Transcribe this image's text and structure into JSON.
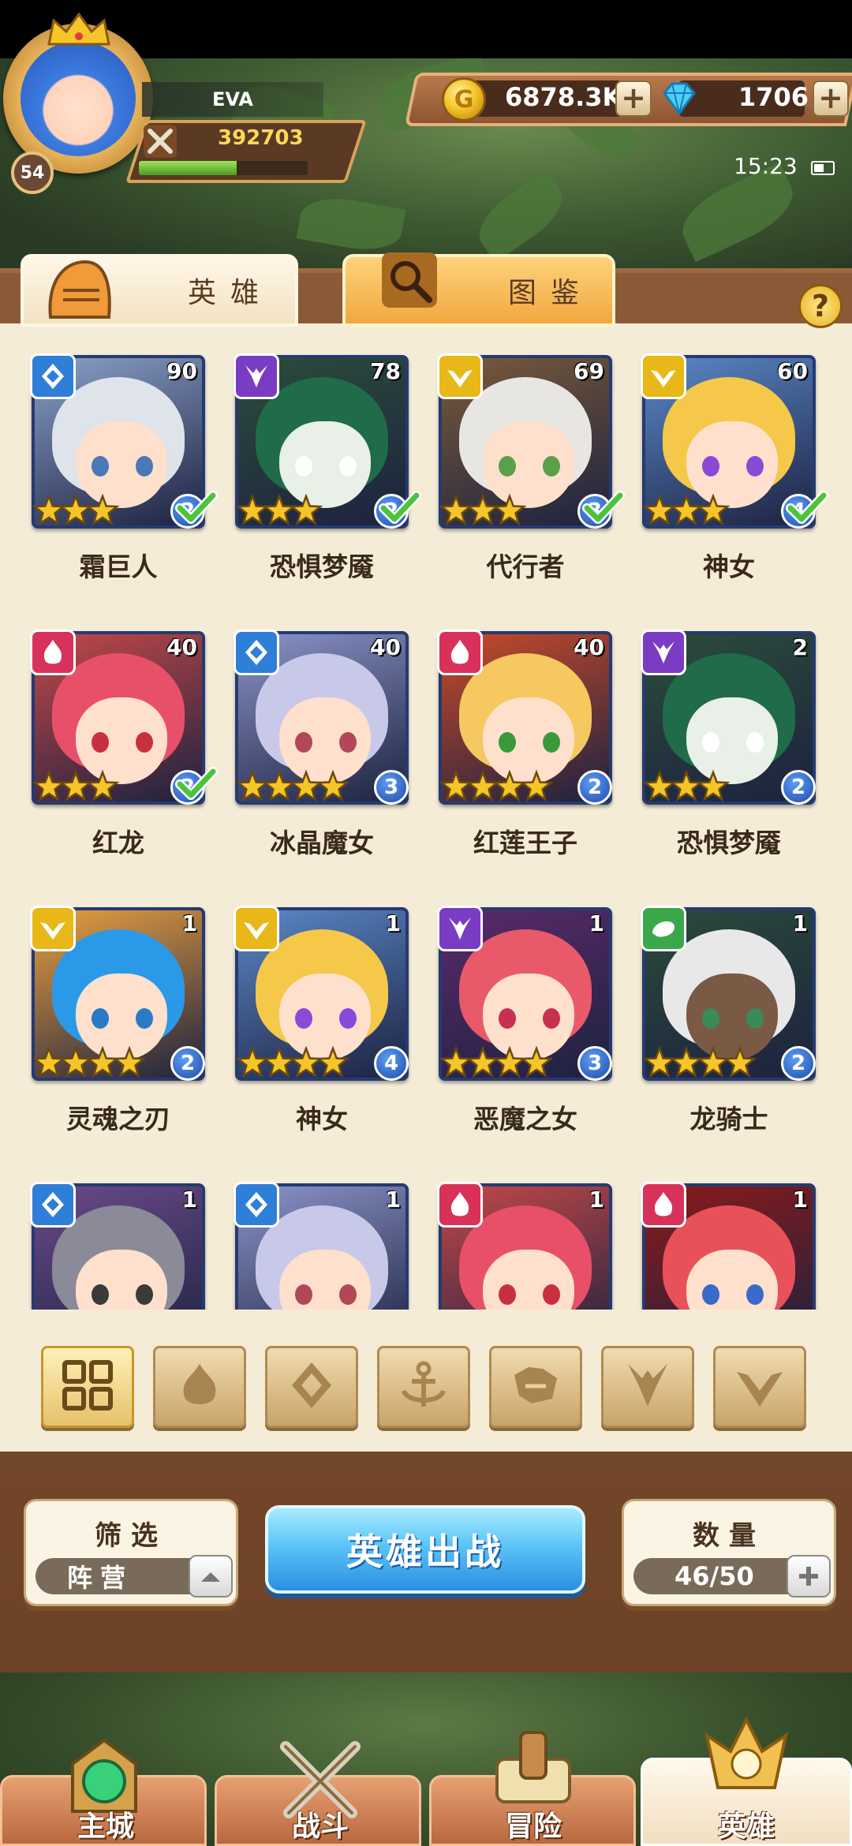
{
  "player": {
    "name": "EVA",
    "level": "54",
    "power": "392703",
    "xp_fraction": 0.58
  },
  "currency": {
    "gold": "6878.3K",
    "gems": "1706",
    "add_label": "+"
  },
  "status": {
    "time": "15:23"
  },
  "tabs": [
    {
      "label": "英雄",
      "icon": "knight-helmet-icon"
    },
    {
      "label": "图鉴",
      "icon": "magnifier-book-icon"
    }
  ],
  "help_label": "?",
  "factions": {
    "water": "#2f7fd8",
    "dark": "#7a3cc2",
    "light": "#e8b818",
    "fire": "#d8325a",
    "nature": "#3aa84a"
  },
  "heroes": [
    {
      "name": "霜巨人",
      "level": "90",
      "faction": "water",
      "stars": 3,
      "star_level": "2",
      "checked": true,
      "hair": "#dfe3ea",
      "bg": "#8aa0c8",
      "eyes": "#4a78b8"
    },
    {
      "name": "恐惧梦魇",
      "level": "78",
      "faction": "dark",
      "stars": 3,
      "star_level": "2",
      "checked": true,
      "hair": "#1f6b4a",
      "bg": "#2b4c3a",
      "eyes": "#ffffff",
      "mask": true
    },
    {
      "name": "代行者",
      "level": "69",
      "faction": "light",
      "stars": 3,
      "star_level": "3",
      "checked": true,
      "hair": "#e8e6e2",
      "bg": "#7a5a3a",
      "eyes": "#5aa04a"
    },
    {
      "name": "神女",
      "level": "60",
      "faction": "light",
      "stars": 3,
      "star_level": "4",
      "checked": true,
      "hair": "#f5c84a",
      "bg": "#5a88c8",
      "eyes": "#8a4ad8"
    },
    {
      "name": "红龙",
      "level": "40",
      "faction": "fire",
      "stars": 3,
      "star_level": "2",
      "checked": true,
      "hair": "#e8506a",
      "bg": "#c24848",
      "eyes": "#c83040"
    },
    {
      "name": "冰晶魔女",
      "level": "40",
      "faction": "water",
      "stars": 4,
      "star_level": "3",
      "checked": false,
      "hair": "#c8c8e8",
      "bg": "#8a94c8",
      "eyes": "#b04858"
    },
    {
      "name": "红莲王子",
      "level": "40",
      "faction": "fire",
      "stars": 4,
      "star_level": "2",
      "checked": false,
      "hair": "#f5c860",
      "bg": "#c84a2a",
      "eyes": "#3a9a3a"
    },
    {
      "name": "恐惧梦魇",
      "level": "2",
      "faction": "dark",
      "stars": 3,
      "star_level": "2",
      "checked": false,
      "hair": "#1f6b4a",
      "bg": "#2b4c3a",
      "eyes": "#ffffff",
      "mask": true
    },
    {
      "name": "灵魂之刃",
      "level": "1",
      "faction": "light",
      "stars": 4,
      "star_level": "2",
      "checked": false,
      "hair": "#2a9ae8",
      "bg": "#e8a040",
      "eyes": "#2a7ac8"
    },
    {
      "name": "神女",
      "level": "1",
      "faction": "light",
      "stars": 4,
      "star_level": "4",
      "checked": false,
      "hair": "#f5c84a",
      "bg": "#5a88c8",
      "eyes": "#8a4ad8"
    },
    {
      "name": "恶魔之女",
      "level": "1",
      "faction": "dark",
      "stars": 4,
      "star_level": "3",
      "checked": false,
      "hair": "#e85a6a",
      "bg": "#5a2a6a",
      "eyes": "#c83050"
    },
    {
      "name": "龙骑士",
      "level": "1",
      "faction": "nature",
      "stars": 4,
      "star_level": "2",
      "checked": false,
      "hair": "#e8e8e8",
      "bg": "#2a4a3a",
      "eyes": "#3a8a5a",
      "dark_skin": true
    },
    {
      "name": "",
      "level": "1",
      "faction": "water",
      "stars": 0,
      "star_level": "",
      "checked": false,
      "hair": "#8a8a98",
      "bg": "#6a4a8a",
      "eyes": "#3a3a3a"
    },
    {
      "name": "",
      "level": "1",
      "faction": "water",
      "stars": 0,
      "star_level": "",
      "checked": false,
      "hair": "#c8c8e8",
      "bg": "#8a94c8",
      "eyes": "#b04858"
    },
    {
      "name": "",
      "level": "1",
      "faction": "fire",
      "stars": 0,
      "star_level": "",
      "checked": false,
      "hair": "#e8506a",
      "bg": "#c24848",
      "eyes": "#c83040"
    },
    {
      "name": "",
      "level": "1",
      "faction": "fire",
      "stars": 0,
      "star_level": "",
      "checked": false,
      "hair": "#e8505a",
      "bg": "#8a1a1a",
      "eyes": "#3a6ac8"
    }
  ],
  "filter_icons": [
    "grid-all-icon",
    "fire-faction-icon",
    "water-faction-icon",
    "anchor-faction-icon",
    "beast-faction-icon",
    "demon-faction-icon",
    "light-faction-icon"
  ],
  "controls": {
    "filter_title": "筛选",
    "filter_value": "阵营",
    "deploy_label": "英雄出战",
    "count_title": "数量",
    "count_value": "46/50"
  },
  "nav": [
    {
      "label": "主城",
      "icon": "castle-orb-icon"
    },
    {
      "label": "战斗",
      "icon": "crossed-swords-icon"
    },
    {
      "label": "冒险",
      "icon": "scroll-map-icon"
    },
    {
      "label": "英雄",
      "icon": "hero-crest-icon"
    }
  ]
}
